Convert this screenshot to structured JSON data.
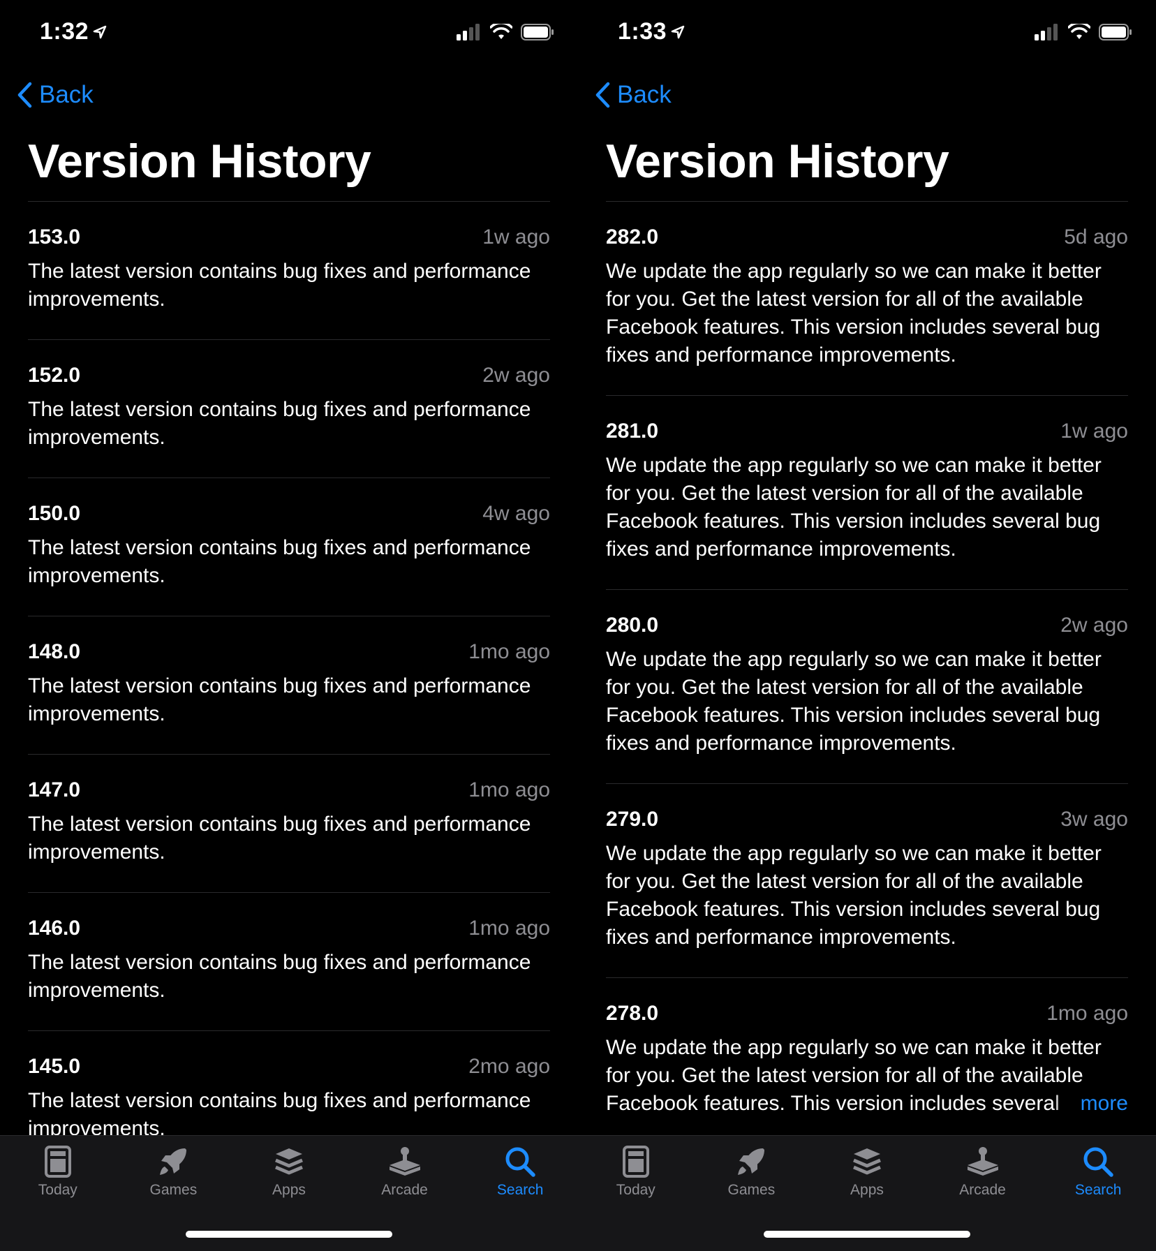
{
  "colors": {
    "accent": "#1d8cff",
    "secondary": "#8e8e93",
    "background": "#000000"
  },
  "screens": [
    {
      "status_time": "1:32",
      "back_label": "Back",
      "title": "Version History",
      "entries": [
        {
          "version": "153.0",
          "date": "1w ago",
          "notes": "The latest version contains bug fixes and performance improvements."
        },
        {
          "version": "152.0",
          "date": "2w ago",
          "notes": "The latest version contains bug fixes and performance improvements."
        },
        {
          "version": "150.0",
          "date": "4w ago",
          "notes": "The latest version contains bug fixes and performance improvements."
        },
        {
          "version": "148.0",
          "date": "1mo ago",
          "notes": "The latest version contains bug fixes and performance improvements."
        },
        {
          "version": "147.0",
          "date": "1mo ago",
          "notes": "The latest version contains bug fixes and performance improvements."
        },
        {
          "version": "146.0",
          "date": "1mo ago",
          "notes": "The latest version contains bug fixes and performance improvements."
        },
        {
          "version": "145.0",
          "date": "2mo ago",
          "notes": "The latest version contains bug fixes and performance improvements."
        }
      ],
      "tabs": [
        {
          "label": "Today",
          "icon": "today-icon",
          "active": false
        },
        {
          "label": "Games",
          "icon": "rocket-icon",
          "active": false
        },
        {
          "label": "Apps",
          "icon": "apps-stack-icon",
          "active": false
        },
        {
          "label": "Arcade",
          "icon": "joystick-icon",
          "active": false
        },
        {
          "label": "Search",
          "icon": "search-icon",
          "active": true
        }
      ]
    },
    {
      "status_time": "1:33",
      "back_label": "Back",
      "title": "Version History",
      "more_label": "more",
      "entries": [
        {
          "version": "282.0",
          "date": "5d ago",
          "notes": "We update the app regularly so we can make it better for you. Get the latest version for all of the available Facebook features. This version includes several bug fixes and performance improvements."
        },
        {
          "version": "281.0",
          "date": "1w ago",
          "notes": "We update the app regularly so we can make it better for you. Get the latest version for all of the available Facebook features. This version includes several bug fixes and performance improvements."
        },
        {
          "version": "280.0",
          "date": "2w ago",
          "notes": "We update the app regularly so we can make it better for you. Get the latest version for all of the available Facebook features. This version includes several bug fixes and performance improvements."
        },
        {
          "version": "279.0",
          "date": "3w ago",
          "notes": "We update the app regularly so we can make it better for you. Get the latest version for all of the available Facebook features. This version includes several bug fixes and performance improvements."
        },
        {
          "version": "278.0",
          "date": "1mo ago",
          "notes": "We update the app regularly so we can make it better for you. Get the latest version for all of the available Facebook features. This version includes several"
        }
      ],
      "tabs": [
        {
          "label": "Today",
          "icon": "today-icon",
          "active": false
        },
        {
          "label": "Games",
          "icon": "rocket-icon",
          "active": false
        },
        {
          "label": "Apps",
          "icon": "apps-stack-icon",
          "active": false
        },
        {
          "label": "Arcade",
          "icon": "joystick-icon",
          "active": false
        },
        {
          "label": "Search",
          "icon": "search-icon",
          "active": true
        }
      ]
    }
  ]
}
